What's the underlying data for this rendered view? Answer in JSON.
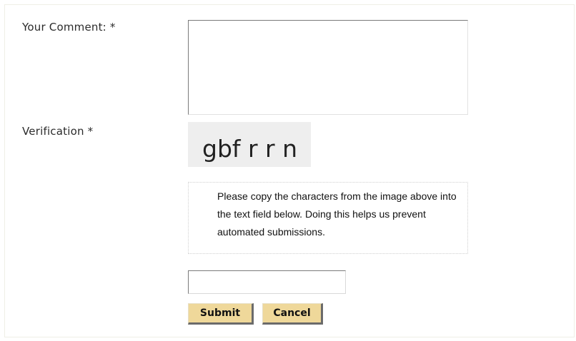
{
  "form": {
    "comment_label": "Your Comment: *",
    "comment_value": "",
    "verification_label": "Verification *",
    "captcha_text": "gbf r r n",
    "captcha_help": "Please copy the characters from the image above into the text field below. Doing this helps us prevent automated submissions.",
    "captcha_input_value": "",
    "submit_label": "Submit",
    "cancel_label": "Cancel"
  },
  "colors": {
    "button_background": "#efd89a",
    "button_shadow": "#6b6b6b",
    "captcha_background": "#eeeeee",
    "panel_border": "#efefe6"
  }
}
